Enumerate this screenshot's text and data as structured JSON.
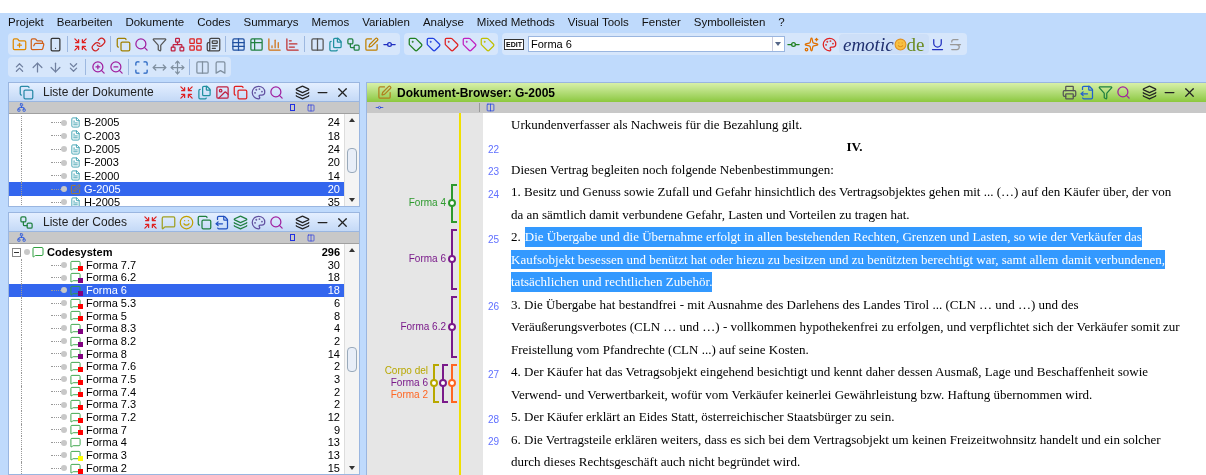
{
  "menu": [
    "Projekt",
    "Bearbeiten",
    "Dokumente",
    "Codes",
    "Summarys",
    "Memos",
    "Variablen",
    "Analyse",
    "Mixed Methods",
    "Visual Tools",
    "Fenster",
    "Symbolleisten",
    "?"
  ],
  "toolbar": {
    "edit_badge": "EDIT",
    "code_field": {
      "value": "Forma 6"
    },
    "logo": {
      "lead": "emotic",
      "tail": "de"
    }
  },
  "documents_panel": {
    "title": "Liste der Dokumente",
    "rows": [
      {
        "name": "B-2005",
        "count": "24",
        "selected": false
      },
      {
        "name": "C-2003",
        "count": "18",
        "selected": false
      },
      {
        "name": "D-2005",
        "count": "24",
        "selected": false
      },
      {
        "name": "F-2003",
        "count": "20",
        "selected": false
      },
      {
        "name": "E-2000",
        "count": "14",
        "selected": false
      },
      {
        "name": "G-2005",
        "count": "20",
        "selected": true
      },
      {
        "name": "H-2005",
        "count": "35",
        "selected": false
      }
    ]
  },
  "codes_panel": {
    "title": "Liste der Codes",
    "root": {
      "name": "Codesystem",
      "count": "296",
      "expanded": true
    },
    "rows": [
      {
        "name": "Forma 7.7",
        "count": "30",
        "color": "#ff0000",
        "selected": false
      },
      {
        "name": "Forma 6.2",
        "count": "18",
        "color": "#800080",
        "selected": false
      },
      {
        "name": "Forma 6",
        "count": "18",
        "color": "#800080",
        "selected": true
      },
      {
        "name": "Forma 5.3",
        "count": "6",
        "color": "#ff0000",
        "selected": false
      },
      {
        "name": "Forma 5",
        "count": "8",
        "color": "#ff0000",
        "selected": false
      },
      {
        "name": "Forma 8.3",
        "count": "4",
        "color": "#800080",
        "selected": false
      },
      {
        "name": "Forma 8.2",
        "count": "2",
        "color": "#800080",
        "selected": false
      },
      {
        "name": "Forma 8",
        "count": "14",
        "color": "#800080",
        "selected": false
      },
      {
        "name": "Forma 7.6",
        "count": "2",
        "color": "#ff0000",
        "selected": false
      },
      {
        "name": "Forma 7.5",
        "count": "3",
        "color": "#ff0000",
        "selected": false
      },
      {
        "name": "Forma 7.4",
        "count": "2",
        "color": "#ff0000",
        "selected": false
      },
      {
        "name": "Forma 7.3",
        "count": "2",
        "color": "#ff0000",
        "selected": false
      },
      {
        "name": "Forma 7.2",
        "count": "12",
        "color": "#ff0000",
        "selected": false
      },
      {
        "name": "Forma 7",
        "count": "9",
        "color": "#ff0000",
        "selected": false
      },
      {
        "name": "Forma 4",
        "count": "13",
        "selected": false
      },
      {
        "name": "Forma 3",
        "count": "13",
        "color": "#ffff00",
        "selected": false
      },
      {
        "name": "Forma 2",
        "count": "15",
        "color": "#ff0000",
        "selected": false
      }
    ]
  },
  "browser": {
    "title": "Dokument-Browser: G-2005",
    "paragraphs": [
      {
        "kind": "text",
        "lines": [
          {
            "text": "Urkundenverfasser als Nachweis für die Bezahlung gilt."
          }
        ]
      },
      {
        "kind": "heading",
        "number": "22",
        "lines": [
          {
            "text": "IV."
          }
        ]
      },
      {
        "kind": "text",
        "number": "23",
        "lines": [
          {
            "text": "Diesen Vertrag begleiten noch folgende Nebenbestimmungen:"
          }
        ]
      },
      {
        "kind": "text",
        "number": "24",
        "codes": [
          {
            "name": "Forma 4",
            "color": "#2e9a2e"
          }
        ],
        "lines": [
          {
            "text": "1. Besitz und Genuss sowie Zufall und Gefahr hinsichtlich des Vertragsobjektes gehen mit ... (…) auf den Käufer über, der von"
          },
          {
            "text": "da an sämtlich damit verbundene Gefahr, Lasten und Vorteilen zu tragen hat."
          }
        ]
      },
      {
        "kind": "text",
        "number": "25",
        "codes": [
          {
            "name": "Forma 6",
            "color": "#7a1a8a"
          }
        ],
        "lines": [
          {
            "prefix": "2.",
            "text": "Die Übergabe und die Übernahme erfolgt in allen bestehenden Rechten, Grenzen und Lasten, so wie der Verkäufer das",
            "selected": true
          },
          {
            "text": "Kaufsobjekt besessen und benützt hat oder hiezu zu besitzen und zu benützten berechtigt war, samt allem damit verbundenen,",
            "selected": true
          },
          {
            "text": "tatsächlichen und rechtlichen Zubehör.",
            "selected": true
          }
        ]
      },
      {
        "kind": "text",
        "number": "26",
        "codes": [
          {
            "name": "Forma 6.2",
            "color": "#7a1a8a"
          }
        ],
        "lines": [
          {
            "text": "3. Die Übergabe hat bestandfrei - mit Ausnahme des Darlehens des Landes Tirol ... (CLN … und …) und des"
          },
          {
            "text": "Veräußerungsverbotes (CLN … und …) - vollkommen hypothekenfrei zu erfolgen, und verpflichtet sich der Verkäufer somit zur"
          },
          {
            "text": "Freistellung vom Pfandrechte (CLN ...) auf seine Kosten."
          }
        ]
      },
      {
        "kind": "text",
        "number": "27",
        "codes": [
          {
            "name": "Corpo del",
            "color": "#b8a800"
          },
          {
            "name": "Forma 6",
            "color": "#7a1a8a"
          },
          {
            "name": "Forma 2",
            "color": "#ff6622"
          }
        ],
        "lines": [
          {
            "text": "4. Der Käufer hat das Vetragsobjekt eingehend besichtigt und kennt daher dessen Ausmaß, Lage und Beschaffenheit sowie"
          },
          {
            "text": "Verwend- und Verwertbarkeit, wofür vom Verkäufer keinerlei Gewährleistung bzw. Haftung übernommen wird."
          }
        ]
      },
      {
        "kind": "text",
        "number": "28",
        "lines": [
          {
            "text": "5. Der Käufer erklärt an Eides Statt, österreichischer Staatsbürger zu sein."
          }
        ]
      },
      {
        "kind": "text",
        "number": "29",
        "lines": [
          {
            "text": "6. Die Vertragsteile erklären weiters, dass es sich bei dem Vertragsobjekt um keinen Freizeitwohnsitz handelt und ein solcher"
          },
          {
            "text": "durch dieses Rechtsgeschäft auch nicht begründet wird."
          }
        ]
      }
    ]
  }
}
